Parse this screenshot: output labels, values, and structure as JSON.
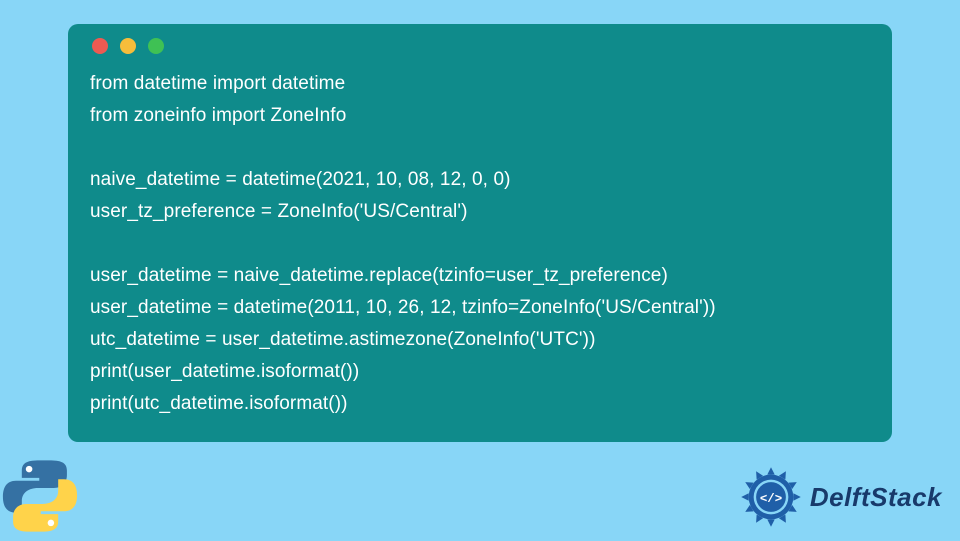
{
  "code": {
    "lines": [
      "from datetime import datetime",
      "from zoneinfo import ZoneInfo",
      "",
      "naive_datetime = datetime(2021, 10, 08, 12, 0, 0)",
      "user_tz_preference = ZoneInfo('US/Central')",
      "",
      "user_datetime = naive_datetime.replace(tzinfo=user_tz_preference)",
      "user_datetime = datetime(2011, 10, 26, 12, tzinfo=ZoneInfo('US/Central'))",
      "utc_datetime = user_datetime.astimezone(ZoneInfo('UTC'))",
      "print(user_datetime.isoformat())",
      "print(utc_datetime.isoformat())"
    ]
  },
  "brand": {
    "name": "DelftStack"
  },
  "colors": {
    "page_bg": "#88d6f7",
    "window_bg": "#0f8b8b",
    "code_text": "#ffffff",
    "brand_text": "#183a6b"
  }
}
